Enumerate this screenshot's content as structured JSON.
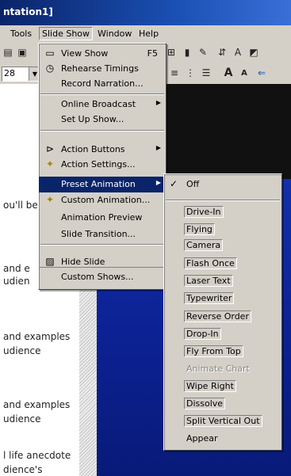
{
  "title": "ntation1]",
  "menubar": {
    "items": [
      "Tools",
      "Slide Show",
      "Window",
      "Help"
    ]
  },
  "toolbar2": {
    "font_size": "28"
  },
  "outline": {
    "lines": [
      "ou'll be",
      "and e",
      "udien",
      "and examples",
      "udience",
      "and examples",
      "udience",
      "l life anecdote",
      "dience's"
    ]
  },
  "slideshow_menu": {
    "items": [
      {
        "label": "View Show",
        "shortcut": "F5",
        "icon": "projector-icon"
      },
      {
        "label": "Rehearse Timings",
        "icon": "stopwatch-icon"
      },
      {
        "label": "Record Narration..."
      },
      {
        "label": "Online Broadcast",
        "submenu": true
      },
      {
        "label": "Set Up Show..."
      },
      {
        "label": "Action Buttons",
        "submenu": true,
        "icon": "action-button-icon"
      },
      {
        "label": "Action Settings...",
        "icon": "action-settings-icon"
      },
      {
        "label": "Preset Animation",
        "submenu": true,
        "highlighted": true
      },
      {
        "label": "Custom Animation...",
        "icon": "custom-animation-icon"
      },
      {
        "label": "Animation Preview"
      },
      {
        "label": "Slide Transition..."
      },
      {
        "label": "Hide Slide",
        "icon": "hide-slide-icon"
      },
      {
        "label": "Custom Shows..."
      }
    ]
  },
  "preset_menu": {
    "items": [
      {
        "label": "Off",
        "checked": true
      },
      {
        "label": "Drive-In"
      },
      {
        "label": "Flying"
      },
      {
        "label": "Camera"
      },
      {
        "label": "Flash Once"
      },
      {
        "label": "Laser Text"
      },
      {
        "label": "Typewriter"
      },
      {
        "label": "Reverse Order"
      },
      {
        "label": "Drop-In"
      },
      {
        "label": "Fly From Top"
      },
      {
        "label": "Animate Chart",
        "disabled": true
      },
      {
        "label": "Wipe Right"
      },
      {
        "label": "Dissolve"
      },
      {
        "label": "Split Vertical Out"
      },
      {
        "label": "Appear"
      }
    ]
  },
  "colors": {
    "titlebar": "#0a246a",
    "highlight": "#0a246a",
    "menu_bg": "#d4d0c8",
    "slide_blue": "#0c2294"
  }
}
